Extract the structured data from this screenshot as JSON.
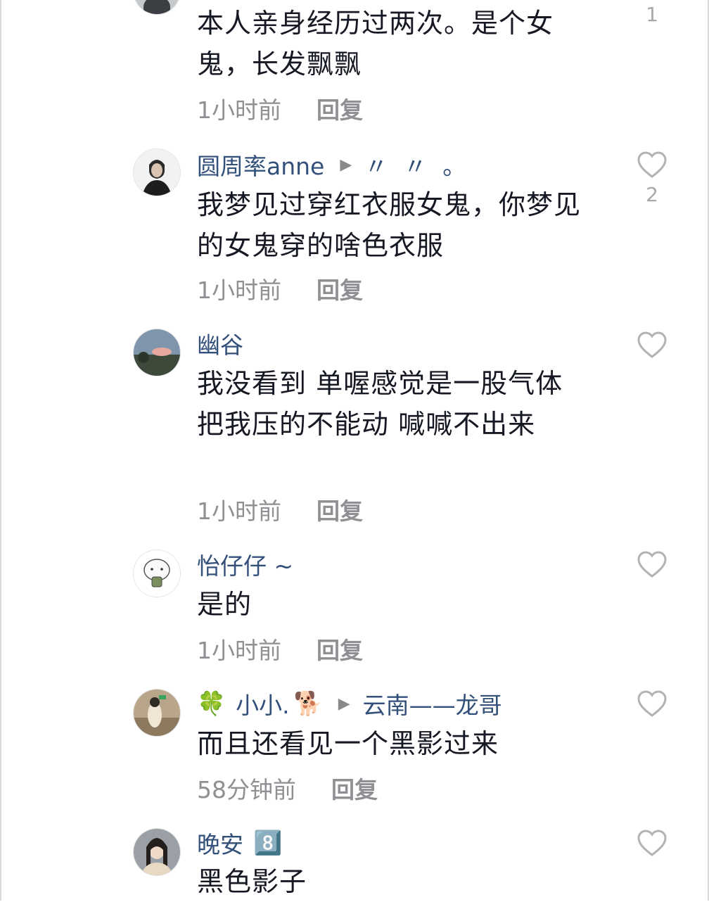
{
  "comments": [
    {
      "text": "本人亲身经历过两次。是个女鬼，长发飘飘",
      "time": "1小时前",
      "reply": "回复",
      "likes": "1"
    },
    {
      "user": "圆周率anne",
      "reply_to": "〃 〃  。",
      "text": "我梦见过穿红衣服女鬼，你梦见的女鬼穿的啥色衣服",
      "time": "1小时前",
      "reply": "回复",
      "likes": "2"
    },
    {
      "user": "幽谷",
      "text": "我没看到 单喔感觉是一股气体 把我压的不能动 喊喊不出来",
      "time": "1小时前",
      "reply": "回复"
    },
    {
      "user": "怡仔仔 ~",
      "text": "是的",
      "time": "1小时前",
      "reply": "回复"
    },
    {
      "user_prefix_emoji": "🍀",
      "user": "小小.",
      "user_suffix_emoji": "🐕",
      "reply_to": "云南——龙哥",
      "text": "而且还看见一个黑影过来",
      "time": "58分钟前",
      "reply": "回复"
    },
    {
      "user": "晚安",
      "user_badge": "8️⃣",
      "text": "黑色影子"
    }
  ],
  "icons": {
    "like": "heart-outline-icon",
    "reply_arrow": "play-triangle-icon"
  },
  "colors": {
    "username": "#33507a",
    "meta": "#8f8f94",
    "text": "#161823"
  }
}
